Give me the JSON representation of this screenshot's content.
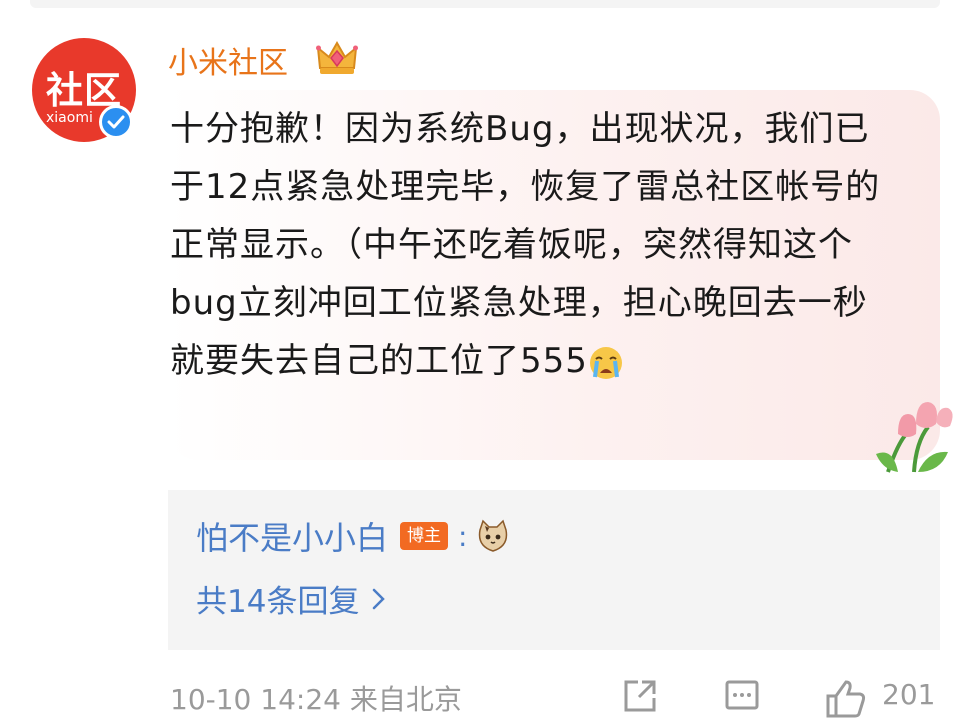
{
  "post": {
    "avatar_text": "社区",
    "avatar_subtext": "xiaomi",
    "username": "小米社区",
    "text": "十分抱歉！因为系统Bug，出现状况，我们已于12点紧急处理完毕，恢复了雷总社区帐号的正常显示。（中午还吃着饭呢，突然得知这个bug立刻冲回工位紧急处理，担心晚回去一秒就要失去自己的工位了555"
  },
  "replies": {
    "first_reply_user": "怕不是小小白",
    "badge": "博主",
    "separator": ":",
    "count_label": "共14条回复"
  },
  "footer": {
    "timestamp": "10-10 14:24 来自北京",
    "likes": "201"
  },
  "icons": [
    "verified-icon",
    "crown-icon",
    "sob-emoji-icon",
    "tulip-sticker-icon",
    "cat-emoji-icon",
    "chevron-right-icon",
    "share-icon",
    "comment-icon",
    "like-icon"
  ],
  "colors": {
    "username": "#e8741a",
    "link": "#4a7cc6",
    "badge": "#f26a22",
    "avatar": "#e8392b",
    "verified": "#2b8ff0"
  }
}
